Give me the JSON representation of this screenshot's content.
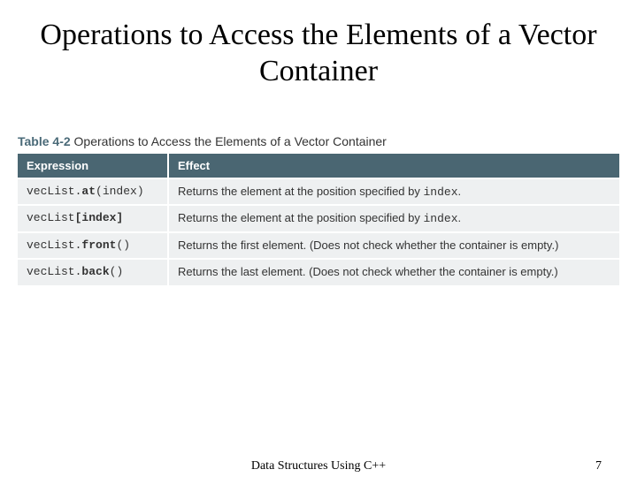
{
  "title": "Operations to Access the Elements of a Vector Container",
  "table": {
    "label_prefix": "Table 4-2",
    "label_rest": "Operations to Access the Elements of a Vector Container",
    "headers": {
      "col1": "Expression",
      "col2": "Effect"
    },
    "rows": [
      {
        "expr_obj": "vecList.",
        "expr_bold": "at",
        "expr_tail": "(index)",
        "effect_pre": "Returns the element at the position specified by ",
        "effect_code": "index",
        "effect_post": "."
      },
      {
        "expr_obj": "vecList",
        "expr_bold": "[index]",
        "expr_tail": "",
        "effect_pre": "Returns the element at the position specified by ",
        "effect_code": "index",
        "effect_post": "."
      },
      {
        "expr_obj": "vecList.",
        "expr_bold": "front",
        "expr_tail": "()",
        "effect_pre": "Returns the first element. (Does not check whether the container is empty.)",
        "effect_code": "",
        "effect_post": ""
      },
      {
        "expr_obj": "vecList.",
        "expr_bold": "back",
        "expr_tail": "()",
        "effect_pre": "Returns the last element. (Does not check whether the container is empty.)",
        "effect_code": "",
        "effect_post": ""
      }
    ]
  },
  "footer": {
    "center": "Data Structures Using C++",
    "page": "7"
  }
}
